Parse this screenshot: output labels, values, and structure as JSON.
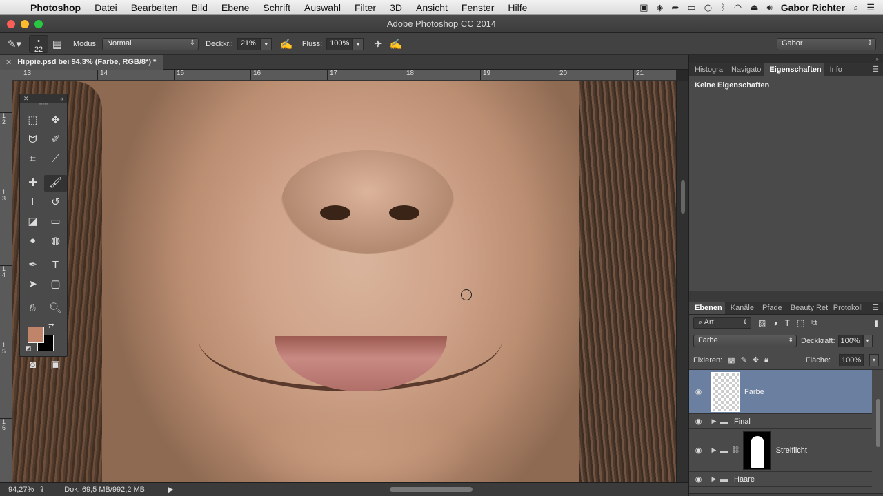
{
  "menubar": {
    "app": "Photoshop",
    "items": [
      "Datei",
      "Bearbeiten",
      "Bild",
      "Ebene",
      "Schrift",
      "Auswahl",
      "Filter",
      "3D",
      "Ansicht",
      "Fenster",
      "Hilfe"
    ],
    "user": "Gabor Richter"
  },
  "window": {
    "title": "Adobe Photoshop CC 2014"
  },
  "options": {
    "brush_size": "22",
    "modus_label": "Modus:",
    "modus_value": "Normal",
    "deckkr_label": "Deckkr.:",
    "deckkr_value": "21%",
    "fluss_label": "Fluss:",
    "fluss_value": "100%",
    "workspace": "Gabor"
  },
  "document": {
    "tab_title": "Hippie.psd bei 94,3% (Farbe, RGB/8*) *",
    "ruler_h": [
      "13",
      "14",
      "15",
      "16",
      "17",
      "18",
      "19",
      "20",
      "21"
    ],
    "ruler_v": [
      "1\n2",
      "1\n3",
      "1\n4",
      "1\n5",
      "1\n6"
    ]
  },
  "status": {
    "zoom": "94,27%",
    "doc": "Dok: 69,5 MB/992,2 MB"
  },
  "colors": {
    "foreground": "#c0846a",
    "background": "#000000",
    "layer_selected": "#6b7fa0"
  },
  "props_panel": {
    "tabs": [
      "Histogra",
      "Navigato",
      "Eigenschaften",
      "Info"
    ],
    "active_tab": "Eigenschaften",
    "header": "Keine Eigenschaften"
  },
  "layers_panel": {
    "tabs": [
      "Ebenen",
      "Kanäle",
      "Pfade",
      "Beauty Ret",
      "Protokoll"
    ],
    "active_tab": "Ebenen",
    "filter": "Art",
    "blend_mode": "Farbe",
    "opacity_label": "Deckkraft:",
    "opacity_value": "100%",
    "lock_label": "Fixieren:",
    "fill_label": "Fläche:",
    "fill_value": "100%",
    "layers": [
      {
        "name": "Farbe",
        "type": "pixel",
        "selected": true
      },
      {
        "name": "Final",
        "type": "group"
      },
      {
        "name": "Streiflicht",
        "type": "group-mask"
      },
      {
        "name": "Haare",
        "type": "group"
      }
    ]
  },
  "icons": {
    "tools": [
      "marquee-icon",
      "move-icon",
      "lasso-icon",
      "quick-select-icon",
      "crop-icon",
      "eyedropper-icon",
      "healing-icon",
      "brush-icon",
      "stamp-icon",
      "history-brush-icon",
      "eraser-icon",
      "gradient-icon",
      "dodge-icon",
      "blur-icon",
      "pen-icon",
      "type-icon",
      "path-select-icon",
      "rectangle-icon",
      "hand-icon",
      "zoom-icon"
    ]
  }
}
